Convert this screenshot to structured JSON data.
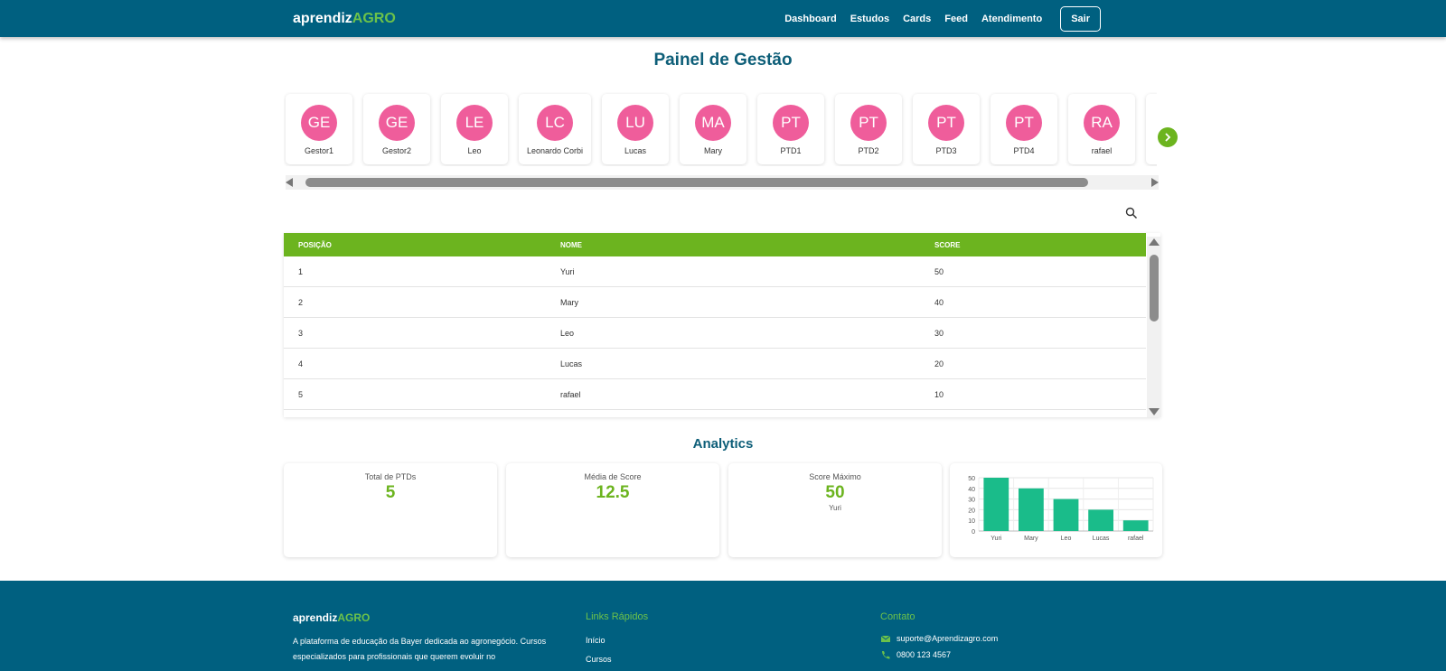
{
  "header": {
    "brand_prefix": "aprendiz",
    "brand_accent": "AGRO",
    "nav": [
      "Dashboard",
      "Estudos",
      "Cards",
      "Feed",
      "Atendimento"
    ],
    "logout_label": "Sair"
  },
  "page_title": "Painel de Gestão",
  "users": [
    {
      "initials": "GE",
      "name": "Gestor1"
    },
    {
      "initials": "GE",
      "name": "Gestor2"
    },
    {
      "initials": "LE",
      "name": "Leo"
    },
    {
      "initials": "LC",
      "name": "Leonardo Corbi"
    },
    {
      "initials": "LU",
      "name": "Lucas"
    },
    {
      "initials": "MA",
      "name": "Mary"
    },
    {
      "initials": "PT",
      "name": "PTD1"
    },
    {
      "initials": "PT",
      "name": "PTD2"
    },
    {
      "initials": "PT",
      "name": "PTD3"
    },
    {
      "initials": "PT",
      "name": "PTD4"
    },
    {
      "initials": "RA",
      "name": "rafael"
    }
  ],
  "ranking": {
    "columns": [
      "POSIÇÃO",
      "NOME",
      "SCORE"
    ],
    "rows": [
      {
        "position": "1",
        "name": "Yuri",
        "score": "50"
      },
      {
        "position": "2",
        "name": "Mary",
        "score": "40"
      },
      {
        "position": "3",
        "name": "Leo",
        "score": "30"
      },
      {
        "position": "4",
        "name": "Lucas",
        "score": "20"
      },
      {
        "position": "5",
        "name": "rafael",
        "score": "10"
      }
    ]
  },
  "analytics": {
    "title": "Analytics",
    "total_ptds": {
      "label": "Total de PTDs",
      "value": "5"
    },
    "media_score": {
      "label": "Média de Score",
      "value": "12.5"
    },
    "score_max": {
      "label": "Score Máximo",
      "value": "50",
      "user": "Yuri"
    }
  },
  "chart_data": {
    "type": "bar",
    "categories": [
      "Yuri",
      "Mary",
      "Leo",
      "Lucas",
      "rafael"
    ],
    "values": [
      50,
      40,
      30,
      20,
      10
    ],
    "yticks": [
      0,
      10,
      20,
      30,
      40,
      50
    ],
    "ylim": [
      0,
      50
    ],
    "grid": true,
    "color": "#1abc8a",
    "title": "",
    "xlabel": "",
    "ylabel": ""
  },
  "footer": {
    "brand_prefix": "aprendiz",
    "brand_accent": "AGRO",
    "description": "A plataforma de educação da Bayer dedicada ao agronegócio. Cursos especializados para profissionais que querem evoluir no",
    "links_title": "Links Rápidos",
    "links": [
      "Início",
      "Cursos"
    ],
    "contact_title": "Contato",
    "email": "suporte@Aprendizagro.com",
    "phone": "0800 123 4567"
  },
  "colors": {
    "primary": "#006080",
    "accent": "#6cb41f",
    "avatar": "#ef5d9b",
    "bar": "#1abc8a"
  },
  "icons": [
    "search-icon",
    "chevron-right-icon",
    "envelope-icon",
    "phone-icon"
  ]
}
